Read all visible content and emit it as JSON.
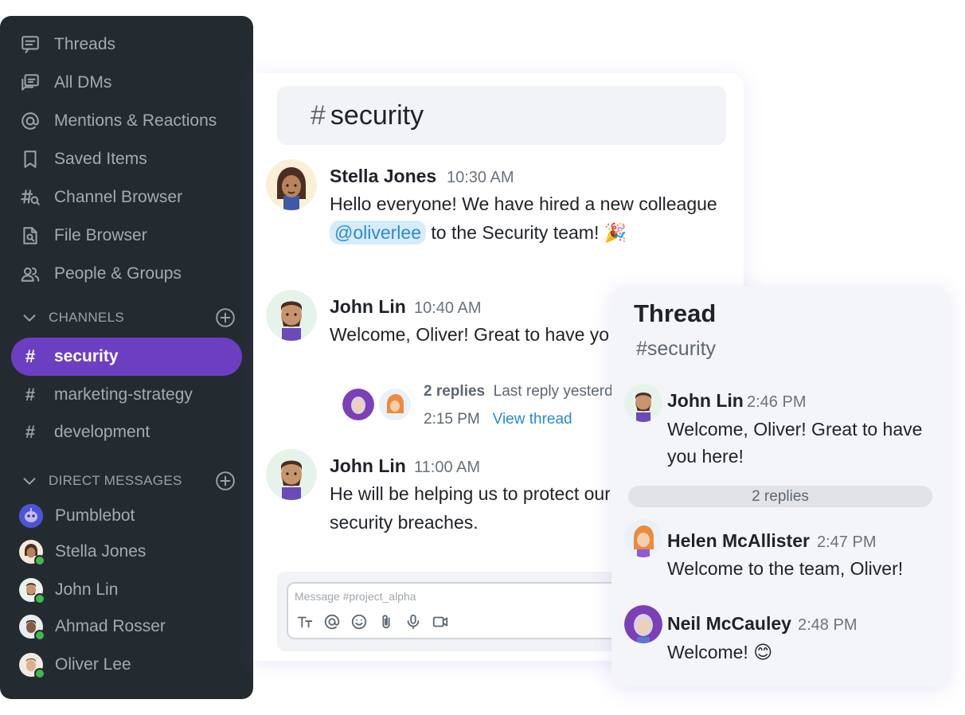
{
  "sidebar": {
    "nav": [
      {
        "label": "Threads",
        "icon": "threads-icon"
      },
      {
        "label": "All DMs",
        "icon": "dms-icon"
      },
      {
        "label": "Mentions & Reactions",
        "icon": "at-icon"
      },
      {
        "label": "Saved Items",
        "icon": "bookmark-icon"
      },
      {
        "label": "Channel Browser",
        "icon": "channel-search-icon"
      },
      {
        "label": "File Browser",
        "icon": "file-search-icon"
      },
      {
        "label": "People & Groups",
        "icon": "people-icon"
      }
    ],
    "channels_header": "CHANNELS",
    "channels": [
      {
        "name": "security",
        "active": true
      },
      {
        "name": "marketing-strategy",
        "active": false
      },
      {
        "name": "development",
        "active": false
      }
    ],
    "dm_header": "DIRECT MESSAGES",
    "dms": [
      {
        "name": "Pumblebot",
        "online": false
      },
      {
        "name": "Stella Jones",
        "online": true
      },
      {
        "name": "John Lin",
        "online": true
      },
      {
        "name": "Ahmad Rosser",
        "online": true
      },
      {
        "name": "Oliver Lee",
        "online": true
      }
    ]
  },
  "chat": {
    "channel_hash": "#",
    "channel_name": "security",
    "messages": [
      {
        "author": "Stella Jones",
        "time": "10:30 AM",
        "line1": "Hello everyone! We have hired a new colleague",
        "mention": "@oliverlee",
        "line2_rest": " to the Security team! ",
        "emoji": "🎉"
      },
      {
        "author": "John Lin",
        "time": "10:40 AM",
        "text": "Welcome, Oliver! Great to have you here!",
        "replies_count": "2 replies",
        "last_reply": "Last reply yesterday at",
        "last_reply_time": "2:15 PM",
        "view_thread": "View thread"
      },
      {
        "author": "John Lin",
        "time": "11:00 AM",
        "line1": "He will be helping us to protect our systems from",
        "line2": "security breaches."
      }
    ],
    "composer": {
      "placeholder": "Message #project_alpha",
      "tools": [
        "text-format-icon",
        "mention-icon",
        "emoji-icon",
        "attach-icon",
        "mic-icon",
        "video-icon"
      ]
    }
  },
  "thread": {
    "title": "Thread",
    "channel": "#security",
    "parent": {
      "author": "John Lin",
      "time": "2:46 PM",
      "line1": "Welcome, Oliver! Great to have",
      "line2": "you here!"
    },
    "replies_label": "2 replies",
    "replies": [
      {
        "author": "Helen McAllister",
        "time": "2:47 PM",
        "text": "Welcome to the team, Oliver!"
      },
      {
        "author": "Neil McCauley",
        "time": "2:48 PM",
        "text": "Welcome! ",
        "emoji": "😊"
      }
    ]
  },
  "colors": {
    "sidebar_bg": "#242b30",
    "active_channel": "#6c3fc2",
    "mention_bg": "#d7ecfa",
    "link": "#2a8bd0",
    "online": "#3fb950"
  }
}
